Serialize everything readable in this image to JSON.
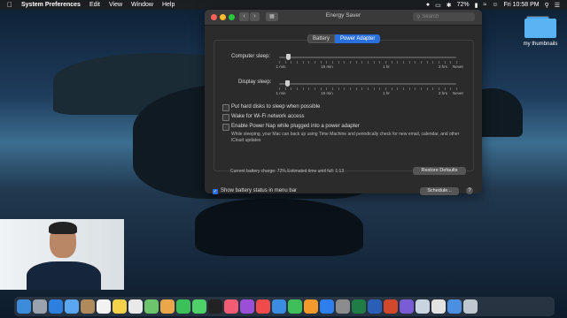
{
  "menubar": {
    "apple_icon": "apple-icon",
    "app_name": "System Preferences",
    "menus": [
      "Edit",
      "View",
      "Window",
      "Help"
    ],
    "battery_percent": "72%",
    "time": "Fri 10:58 PM"
  },
  "desktop": {
    "folder_label": "my thumbnails"
  },
  "window": {
    "title": "Energy Saver",
    "search_placeholder": "Search",
    "tabs": [
      {
        "label": "Battery",
        "active": false
      },
      {
        "label": "Power Adapter",
        "active": true
      }
    ],
    "computer_sleep": {
      "label": "Computer sleep:",
      "value": "1 min",
      "ticks": [
        "1 min",
        "15 min",
        "1 hr",
        "3 hrs",
        "Never"
      ]
    },
    "display_sleep": {
      "label": "Display sleep:",
      "value": "1 min",
      "ticks": [
        "1 min",
        "15 min",
        "1 hr",
        "3 hrs",
        "Never"
      ]
    },
    "options": [
      {
        "label": "Put hard disks to sleep when possible",
        "checked": false
      },
      {
        "label": "Wake for Wi-Fi network access",
        "checked": false
      },
      {
        "label": "Enable Power Nap while plugged into a power adapter",
        "checked": false
      }
    ],
    "power_nap_description": "While sleeping, your Mac can back up using Time Machine and periodically check for new email, calendar, and other iCloud updates",
    "battery_status": "Current battery charge: 72% Estimated time until full: 1:13",
    "restore_button": "Restore Defaults",
    "show_battery_label": "Show battery status in menu bar",
    "show_battery_checked": true,
    "schedule_button": "Schedule...",
    "help_button": "?"
  },
  "colors": {
    "accent": "#2a6fde",
    "window_bg": "#2b2b2b"
  },
  "dock": {
    "icons": [
      "finder-icon",
      "launchpad-icon",
      "safari-icon",
      "mail-icon",
      "contacts-icon",
      "calendar-icon",
      "notes-icon",
      "reminders-icon",
      "maps-icon",
      "photos-icon",
      "facetime-icon",
      "messages-icon",
      "appletv-icon",
      "music-icon",
      "podcasts-icon",
      "news-icon",
      "keynote-icon",
      "numbers-icon",
      "pages-icon",
      "appstore-icon",
      "sysprefs-icon",
      "excel-icon",
      "word-icon",
      "powerpoint-icon",
      "imovie-icon",
      "preview-icon",
      "chrome-icon",
      "downloads-icon",
      "trash-icon"
    ]
  }
}
